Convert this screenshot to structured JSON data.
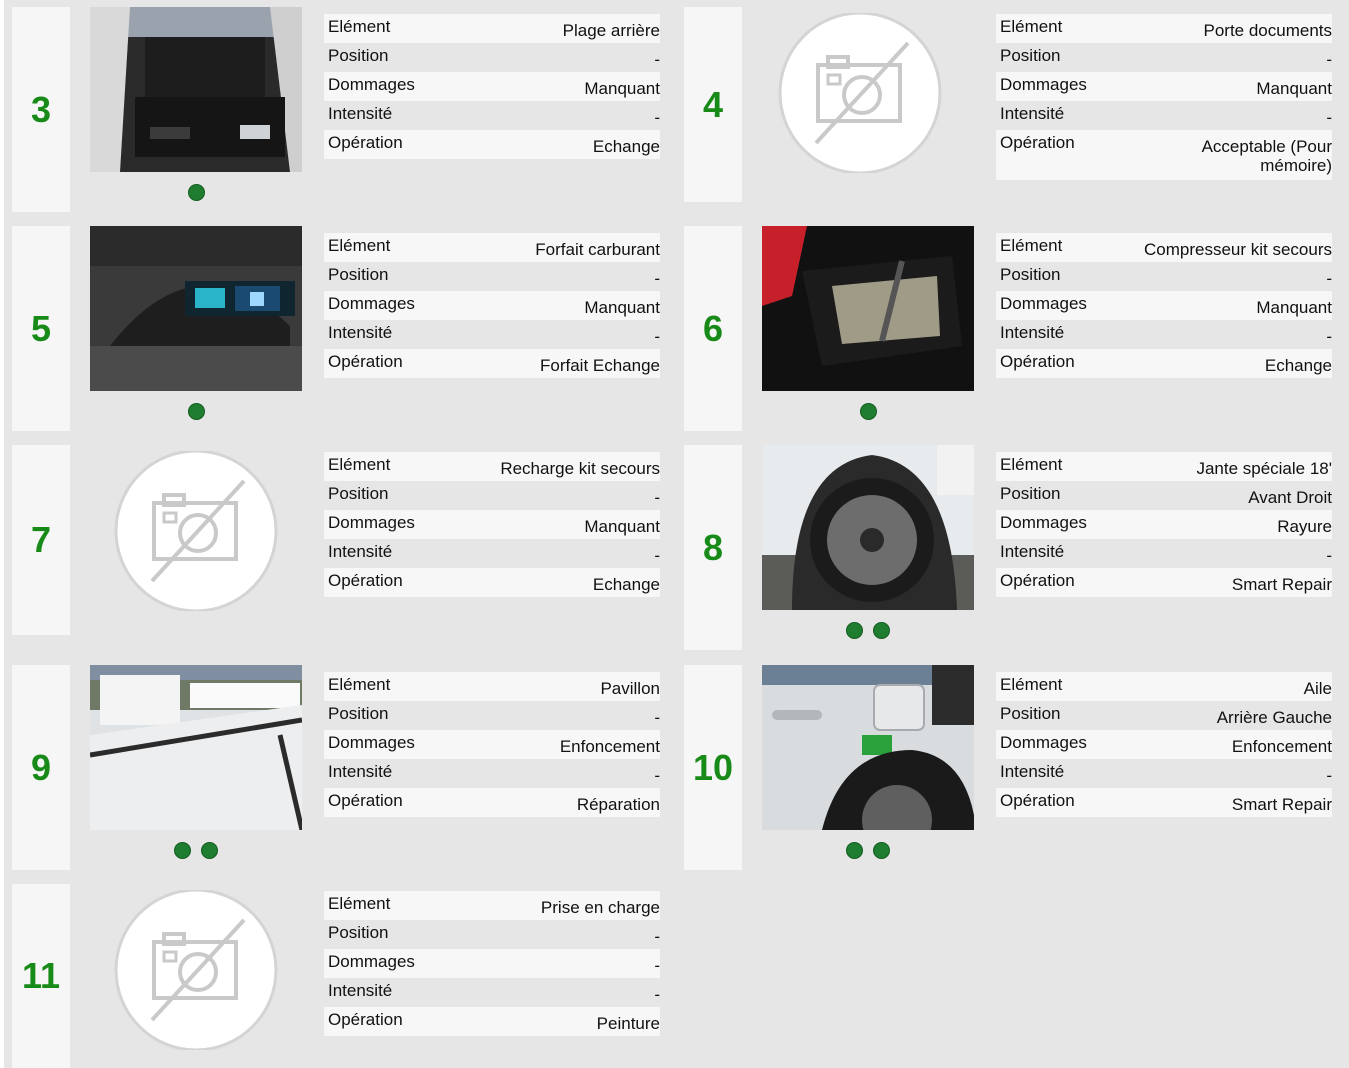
{
  "row_labels": {
    "element": "Elément",
    "position": "Position",
    "dommages": "Dommages",
    "intensite": "Intensité",
    "operation": "Opération"
  },
  "items": [
    {
      "number": "3",
      "element": "Plage arrière",
      "position": "-",
      "dommages": "Manquant",
      "intensite": "-",
      "operation": "Echange",
      "has_photo": true,
      "photo_dots": 1
    },
    {
      "number": "4",
      "element": "Porte documents",
      "position": "-",
      "dommages": "Manquant",
      "intensite": "-",
      "operation": "Acceptable (Pour mémoire)",
      "has_photo": false,
      "photo_dots": 0
    },
    {
      "number": "5",
      "element": "Forfait carburant",
      "position": "-",
      "dommages": "Manquant",
      "intensite": "-",
      "operation": "Forfait Echange",
      "has_photo": true,
      "photo_dots": 1
    },
    {
      "number": "6",
      "element": "Compresseur kit secours",
      "position": "-",
      "dommages": "Manquant",
      "intensite": "-",
      "operation": "Echange",
      "has_photo": true,
      "photo_dots": 1
    },
    {
      "number": "7",
      "element": "Recharge kit secours",
      "position": "-",
      "dommages": "Manquant",
      "intensite": "-",
      "operation": "Echange",
      "has_photo": false,
      "photo_dots": 0
    },
    {
      "number": "8",
      "element": "Jante spéciale 18'",
      "position": "Avant Droit",
      "dommages": "Rayure",
      "intensite": "-",
      "operation": "Smart Repair",
      "has_photo": true,
      "photo_dots": 2
    },
    {
      "number": "9",
      "element": "Pavillon",
      "position": "-",
      "dommages": "Enfoncement",
      "intensite": "-",
      "operation": "Réparation",
      "has_photo": true,
      "photo_dots": 2
    },
    {
      "number": "10",
      "element": "Aile",
      "position": "Arrière Gauche",
      "dommages": "Enfoncement",
      "intensite": "-",
      "operation": "Smart Repair",
      "has_photo": true,
      "photo_dots": 2
    },
    {
      "number": "11",
      "element": "Prise en charge",
      "position": "-",
      "dommages": "-",
      "intensite": "-",
      "operation": "Peinture",
      "has_photo": false,
      "photo_dots": 0
    }
  ],
  "colors": {
    "accent_green": "#178a17",
    "dot_green": "#1f7d2f",
    "page_bg": "#e6e6e6"
  }
}
